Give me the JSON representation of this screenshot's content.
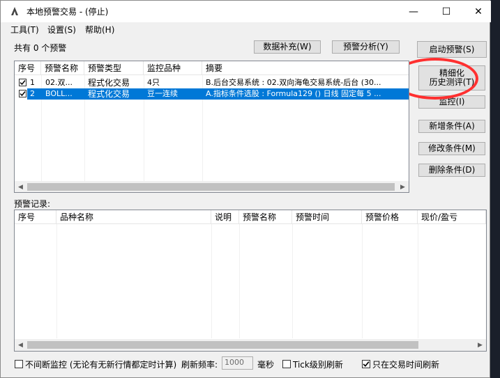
{
  "window": {
    "title": "本地预警交易 - (停止)",
    "controls": {
      "minimize": "—",
      "maximize": "☐",
      "close": "✕"
    }
  },
  "menu": [
    "工具(T)",
    "设置(S)",
    "帮助(H)"
  ],
  "summary": "共有 0 个预警",
  "buttons": {
    "data_supplement": "数据补充(W)",
    "alert_analysis": "预警分析(Y)",
    "start_alert": "启动预警(S)",
    "refine_line1": "精细化",
    "refine_line2": "历史测评(T)",
    "monitor": "监控(I)",
    "add_condition": "新增条件(A)",
    "edit_condition": "修改条件(M)",
    "delete_condition": "删除条件(D)"
  },
  "alerts_table": {
    "headers": [
      "序号",
      "预警名称",
      "预警类型",
      "监控品种",
      "摘要"
    ],
    "rows": [
      {
        "checked": true,
        "no": "1",
        "name": "02.双...",
        "type": "程式化交易",
        "symbol": "4只",
        "summary": "B.后台交易系统 : 02.双向海龟交易系统-后台 (30...",
        "selected": false
      },
      {
        "checked": true,
        "no": "2",
        "name": "BOLL...",
        "type": "程式化交易",
        "symbol": "豆一连续",
        "summary": "A.指标条件选股 : Formula129 () 日线 固定每 5 ...",
        "selected": true
      }
    ]
  },
  "records_label": "预警记录:",
  "records_table": {
    "headers": [
      "序号",
      "品种名称",
      "说明",
      "预警名称",
      "预警时间",
      "预警价格",
      "现价/盈亏"
    ]
  },
  "footer": {
    "continuous_monitor": "不间断监控 (无论有无新行情都定时计算)",
    "continuous_checked": false,
    "refresh_freq_label": "刷新频率:",
    "refresh_freq_value": "1000",
    "unit": "毫秒",
    "tick_refresh": "Tick级别刷新",
    "tick_checked": false,
    "trade_time_refresh": "只在交易时间刷新",
    "trade_time_checked": true
  },
  "colors": {
    "selection": "#0078d7",
    "highlight_circle": "#ff3030"
  }
}
